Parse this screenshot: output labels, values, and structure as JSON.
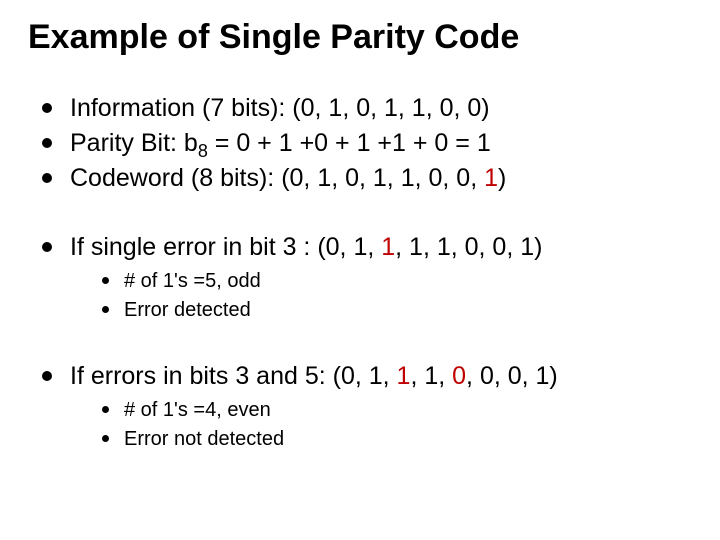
{
  "title": "Example of Single Parity Code",
  "items": [
    {
      "seg": [
        {
          "t": "Information (7 bits):  (0, 1, 0, 1, 1, 0, 0)"
        }
      ]
    },
    {
      "seg": [
        {
          "t": "Parity Bit: b"
        },
        {
          "t": "8",
          "sub": true
        },
        {
          "t": " = 0 + 1 +0 + 1 +1 + 0 = 1"
        }
      ]
    },
    {
      "seg": [
        {
          "t": "Codeword (8 bits): (0, 1, 0, 1, 1, 0, 0, "
        },
        {
          "t": "1",
          "red": true
        },
        {
          "t": ")"
        }
      ]
    },
    {
      "gap": true,
      "seg": [
        {
          "t": "If single error in bit 3 : (0, 1, "
        },
        {
          "t": "1",
          "red": true
        },
        {
          "t": ", 1, 1, 0, 0, 1)"
        }
      ],
      "sub": [
        {
          "seg": [
            {
              "t": "# of 1's =5, odd"
            }
          ]
        },
        {
          "seg": [
            {
              "t": "Error detected"
            }
          ]
        }
      ]
    },
    {
      "gap": true,
      "seg": [
        {
          "t": "If errors in bits 3 and 5: (0, 1, "
        },
        {
          "t": "1",
          "red": true
        },
        {
          "t": ", 1, "
        },
        {
          "t": "0",
          "red": true
        },
        {
          "t": ", 0, 0, 1)"
        }
      ],
      "sub": [
        {
          "seg": [
            {
              "t": "# of 1's =4, even"
            }
          ]
        },
        {
          "seg": [
            {
              "t": "Error not detected"
            }
          ]
        }
      ]
    }
  ]
}
